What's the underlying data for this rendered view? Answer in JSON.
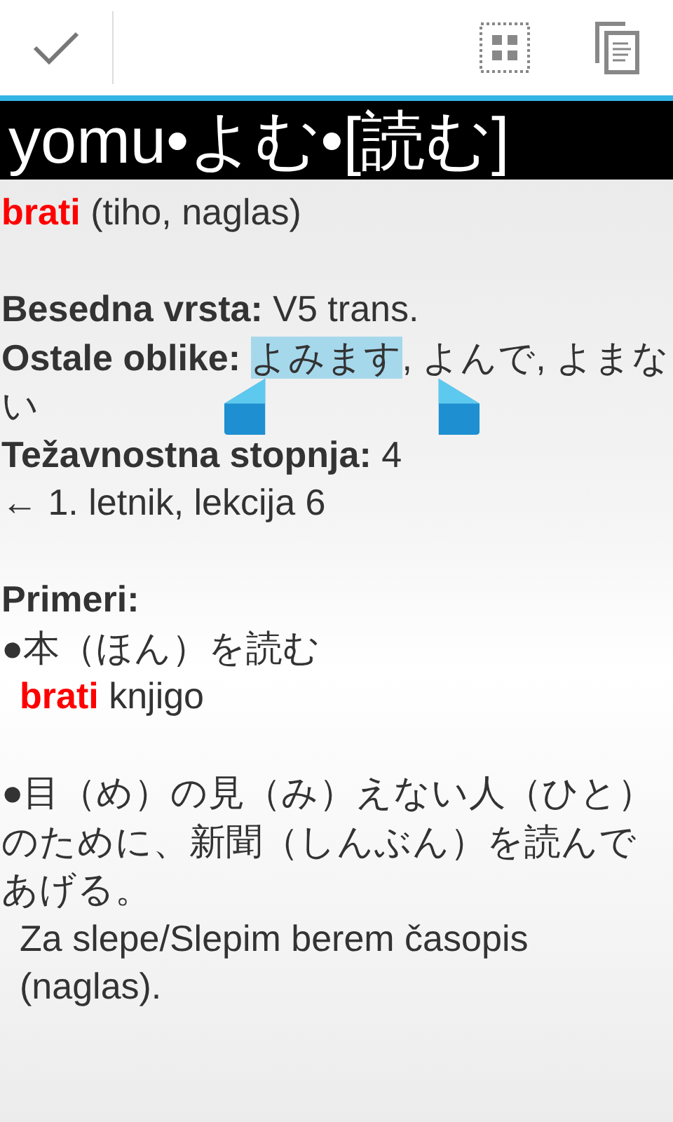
{
  "title": "yomu•よむ•[読む]",
  "meaning": {
    "highlight": "brati",
    "rest": " (tiho, naglas)"
  },
  "fields": [
    {
      "label": "Besedna vrsta:",
      "value": "V5 trans."
    },
    {
      "label": "Ostale oblike:",
      "segments": [
        {
          "text": "よみます",
          "selected": true
        },
        {
          "text": ", よんで, よまない",
          "selected": false
        }
      ]
    },
    {
      "label": "Težavnostna stopnja:",
      "value": "4"
    }
  ],
  "lesson": "← 1. letnik, lekcija 6",
  "examples_heading": "Primeri:",
  "examples": [
    {
      "japanese": "●本（ほん）を読む",
      "highlight": "brati",
      "translation": "knjigo"
    },
    {
      "japanese": "●目（め）の見（み）えない人（ひと）のために、新聞（しんぶん）を読んであげる。",
      "translation": "Za slepe/Slepim berem časopis (naglas)."
    }
  ]
}
